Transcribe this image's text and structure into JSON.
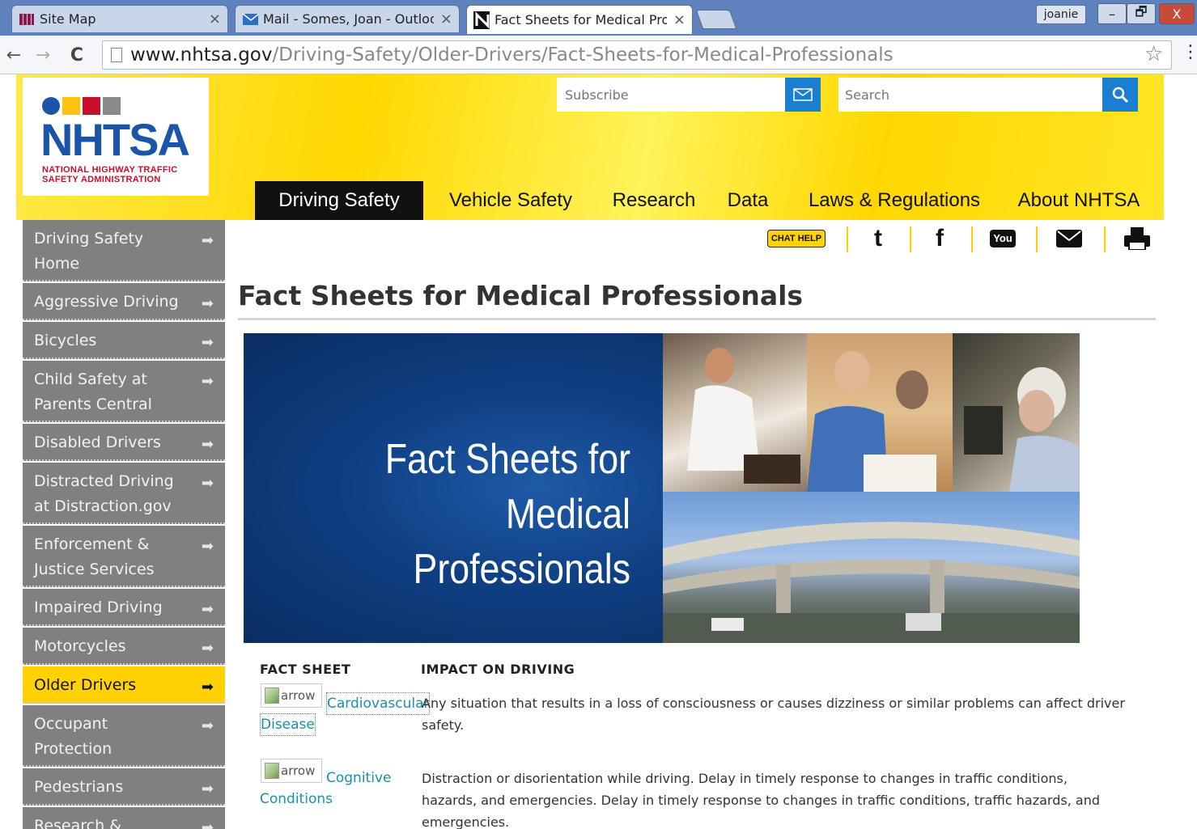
{
  "browser": {
    "tabs": [
      {
        "label": "Site Map",
        "close": "×"
      },
      {
        "label": "Mail - Somes, Joan - Outlook",
        "close": "×"
      },
      {
        "label": "Fact Sheets for Medical Prof",
        "close": "×"
      }
    ],
    "user": "joanie",
    "window_buttons": {
      "minimize": "–",
      "restore": "🗗",
      "close": "X"
    },
    "back": "←",
    "forward": "→",
    "reload": "C",
    "url_host": "www.nhtsa.gov",
    "url_path": "/Driving-Safety/Older-Drivers/Fact-Sheets-for-Medical-Professionals",
    "bookmark_star": "☆",
    "menu": "⋮"
  },
  "header": {
    "logo_text": "NHTSA",
    "logo_sub_line1": "NATIONAL HIGHWAY TRAFFIC",
    "logo_sub_line2": "SAFETY ADMINISTRATION",
    "subscribe_placeholder": "Subscribe",
    "search_placeholder": "Search"
  },
  "nav": [
    {
      "label": "Driving Safety",
      "active": true
    },
    {
      "label": "Vehicle Safety",
      "active": false
    },
    {
      "label": "Research",
      "active": false
    },
    {
      "label": "Data",
      "active": false
    },
    {
      "label": "Laws & Regulations",
      "active": false
    },
    {
      "label": "About NHTSA",
      "active": false
    }
  ],
  "sidebar": [
    {
      "label": "Driving Safety Home"
    },
    {
      "label": "Aggressive Driving"
    },
    {
      "label": "Bicycles"
    },
    {
      "label": "Child Safety at Parents Central"
    },
    {
      "label": "Disabled Drivers"
    },
    {
      "label": "Distracted Driving at Distraction.gov"
    },
    {
      "label": "Enforcement & Justice Services"
    },
    {
      "label": "Impaired Driving"
    },
    {
      "label": "Motorcycles"
    },
    {
      "label": "Older Drivers",
      "active": true
    },
    {
      "label": "Occupant Protection"
    },
    {
      "label": "Pedestrians"
    },
    {
      "label": "Research &"
    }
  ],
  "sidebar_arrow": "➡",
  "social": {
    "chat_help": "CHAT HELP",
    "twitter": "t",
    "facebook": "f",
    "youtube": "You"
  },
  "page": {
    "title": "Fact Sheets for Medical Professionals",
    "hero_line1": "Fact Sheets for",
    "hero_line2": "Medical Professionals"
  },
  "fact_table": {
    "col_fact_sheet": "FACT SHEET",
    "col_impact": "IMPACT ON DRIVING",
    "rows": [
      {
        "img_alt": "arrow",
        "link_part1": "Cardiovascular",
        "link_part2": "Disease",
        "impact": "Any situation that results in a loss of consciousness or causes dizziness or similar problems can affect driver safety."
      },
      {
        "img_alt": "arrow",
        "link_part1": "Cognitive",
        "link_part2": "Conditions",
        "impact": "Distraction or disorientation while driving. Delay in timely response to changes in traffic conditions, hazards, and emergencies. Delay in timely response to changes in traffic conditions, traffic hazards, and emergencies."
      }
    ]
  },
  "colors": {
    "header_yellow": "#ffd800",
    "nav_active_bg": "#111111",
    "sidebar_gray": "#808080",
    "sidebar_active": "#ffd200",
    "button_blue": "#1b7fd1",
    "hero_blue": "#0f3f82",
    "link": "#1a8fb0"
  }
}
